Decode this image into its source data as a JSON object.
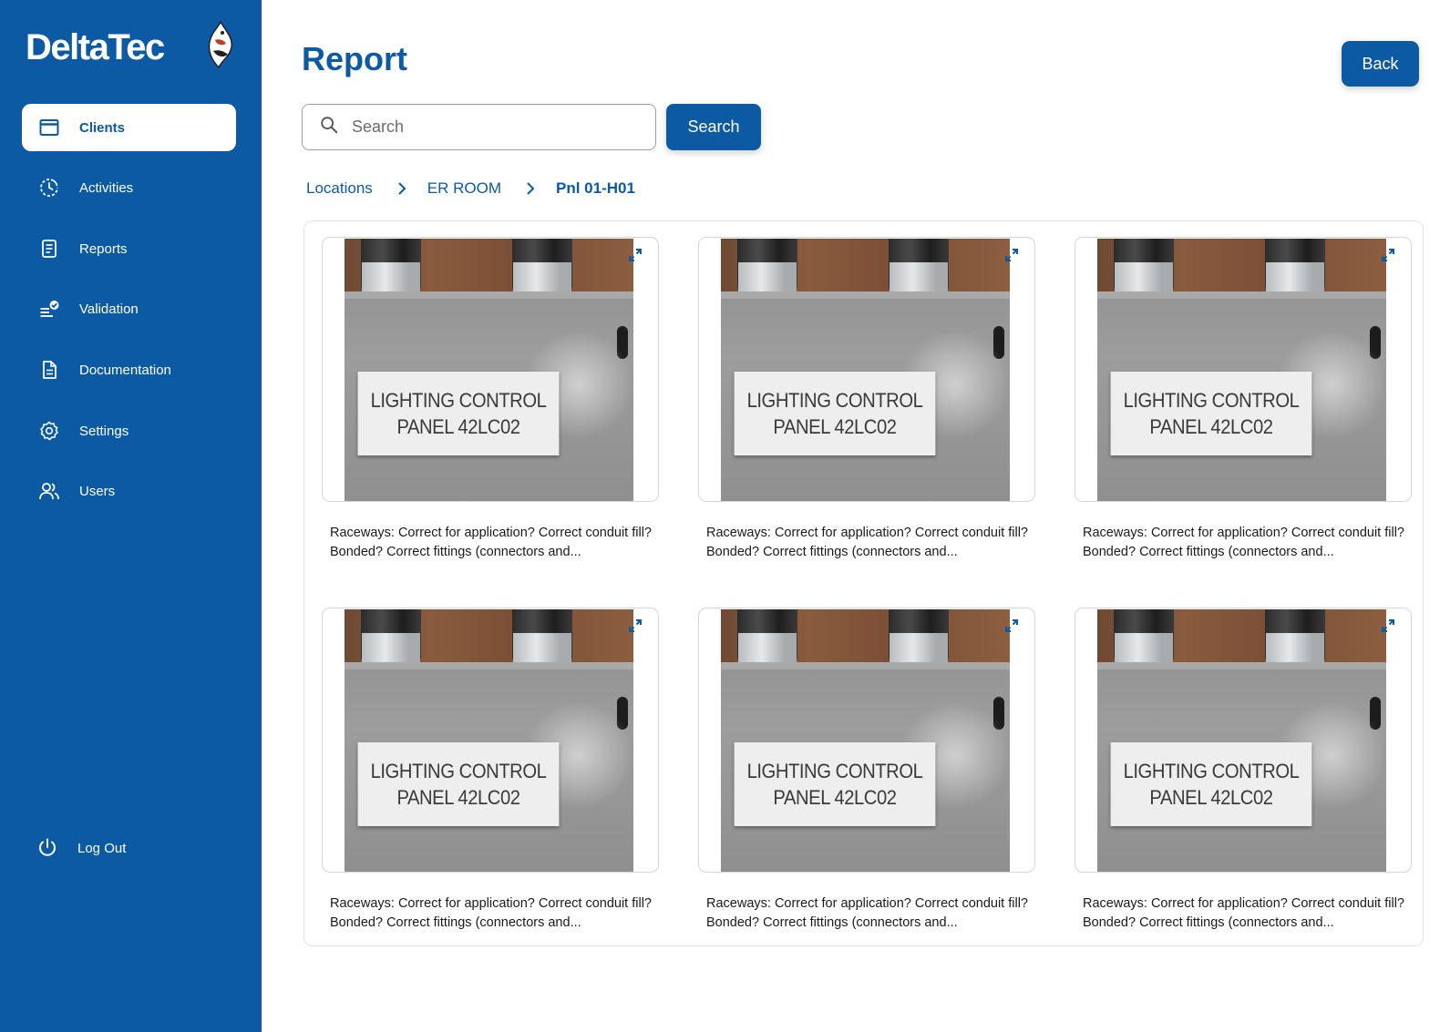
{
  "brand": {
    "name": "DeltaTec"
  },
  "colors": {
    "primary": "#0b5aa3",
    "sidebar_bg": "#0b5aa3",
    "text": "#1a1a1a"
  },
  "sidebar": {
    "items": [
      {
        "label": "Clients",
        "icon": "window-icon",
        "active": true
      },
      {
        "label": "Activities",
        "icon": "activity-icon",
        "active": false
      },
      {
        "label": "Reports",
        "icon": "report-document-icon",
        "active": false
      },
      {
        "label": "Validation",
        "icon": "validation-check-icon",
        "active": false
      },
      {
        "label": "Documentation",
        "icon": "document-icon",
        "active": false
      },
      {
        "label": "Settings",
        "icon": "gear-icon",
        "active": false
      },
      {
        "label": "Users",
        "icon": "users-icon",
        "active": false
      }
    ],
    "logout": {
      "label": "Log Out",
      "icon": "power-icon"
    }
  },
  "header": {
    "title": "Report",
    "back_label": "Back"
  },
  "search": {
    "placeholder": "Search",
    "value": "",
    "button_label": "Search"
  },
  "breadcrumb": {
    "items": [
      "Locations",
      "ER ROOM"
    ],
    "current": "Pnl 01-H01"
  },
  "gallery": {
    "cards": [
      {
        "plate_line1": "LIGHTING CONTROL",
        "plate_line2": "PANEL 42LC02",
        "caption": "Raceways: Correct for application? Correct conduit fill? Bonded? Correct fittings (connectors and..."
      },
      {
        "plate_line1": "LIGHTING CONTROL",
        "plate_line2": "PANEL 42LC02",
        "caption": "Raceways: Correct for application? Correct conduit fill? Bonded? Correct fittings (connectors and..."
      },
      {
        "plate_line1": "LIGHTING CONTROL",
        "plate_line2": "PANEL 42LC02",
        "caption": "Raceways: Correct for application? Correct conduit fill? Bonded? Correct fittings (connectors and..."
      },
      {
        "plate_line1": "LIGHTING CONTROL",
        "plate_line2": "PANEL 42LC02",
        "caption": "Raceways: Correct for application? Correct conduit fill? Bonded? Correct fittings (connectors and..."
      },
      {
        "plate_line1": "LIGHTING CONTROL",
        "plate_line2": "PANEL 42LC02",
        "caption": "Raceways: Correct for application? Correct conduit fill? Bonded? Correct fittings (connectors and..."
      },
      {
        "plate_line1": "LIGHTING CONTROL",
        "plate_line2": "PANEL 42LC02",
        "caption": "Raceways: Correct for application? Correct conduit fill? Bonded? Correct fittings (connectors and..."
      }
    ]
  }
}
